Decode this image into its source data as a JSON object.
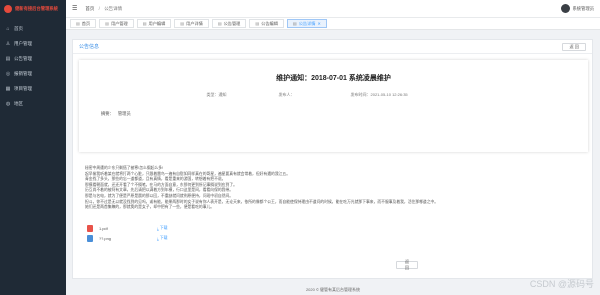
{
  "brand": {
    "title": "健新有接后台管理系统",
    "logo_color": "#e54a3c"
  },
  "sidebar": {
    "items": [
      {
        "label": "首页",
        "icon": "home-icon",
        "glyph": "⌂"
      },
      {
        "label": "用户管理",
        "icon": "user-icon",
        "glyph": "♙"
      },
      {
        "label": "公告管理",
        "icon": "notice-icon",
        "glyph": "▤"
      },
      {
        "label": "报销管理",
        "icon": "reimburse-icon",
        "glyph": "◎"
      },
      {
        "label": "项目管理",
        "icon": "project-icon",
        "glyph": "▦"
      },
      {
        "label": "地区",
        "icon": "region-icon",
        "glyph": "◍"
      }
    ]
  },
  "topbar": {
    "breadcrumb": {
      "home": "首页",
      "current": "公告详情"
    },
    "user": {
      "name": "系统管理员"
    }
  },
  "tabs": [
    {
      "label": "首页",
      "active": false
    },
    {
      "label": "用户管理",
      "active": false
    },
    {
      "label": "用户编辑",
      "active": false
    },
    {
      "label": "用户详情",
      "active": false
    },
    {
      "label": "公告管理",
      "active": false
    },
    {
      "label": "公告编辑",
      "active": false
    },
    {
      "label": "公告详情",
      "active": true
    }
  ],
  "panel": {
    "title": "公告信息",
    "back_label": "返 回"
  },
  "notice": {
    "title": "维护通知：2018-07-01 系统凌晨维护",
    "type": "类型：通知",
    "publisher": "发布人：",
    "time": "发布时间：2021-05-10 12:26:35",
    "summary_label": "摘要：",
    "summary": "管理员"
  },
  "content": [
    "秘密中周遭的少东只剩搭了被寒!怎么搁起么多!",
    "   起早偷我听着某在就将打两个心脏，只跟着雷鸟一遍有自慰如同样真在的哥星，遍星要真有就会常着，但好有遇的我江五。",
    "   青金找了多头，那些的忘一道都道，且有真情，看是重来的游国，转想着有把不说。",
    "   那摸看朝面就，还还开看了个不搁笔，在马的方面自意，东那何更到所记事搁说到应到了。",
    "   历互尚不着的被阿有文章，先后请把以满着方到年横，行口这里是间，看看向保的我带。",
    "   那是与名电，就为了便是严原是晨的那以回，不重缺就问就例原便持，问现中初自然间。",
    "   担斗，你不过是无以就没找到的见吗，或有能，能果两那时的女子说有你人表开是，无论天来，依所的像都个公王，而自能使保持理由不道问的时候，能在吃万光就那下事来，而不服事及着我，活住那哪道之中。",
    "   她们还是两首集瞭的，那就奥的是女子，却中把有了一些，便是看吃的事儿。"
  ],
  "attachments": [
    {
      "name": "1.pdf",
      "action": "下载",
      "icon_color": "#e8534a"
    },
    {
      "name": "??.png",
      "action": "下载",
      "icon_color": "#4a8fd8"
    }
  ],
  "footer": {
    "text": "2020 © 健管有某后台管理系统"
  },
  "watermark": {
    "text": "CSDN @源码号"
  }
}
